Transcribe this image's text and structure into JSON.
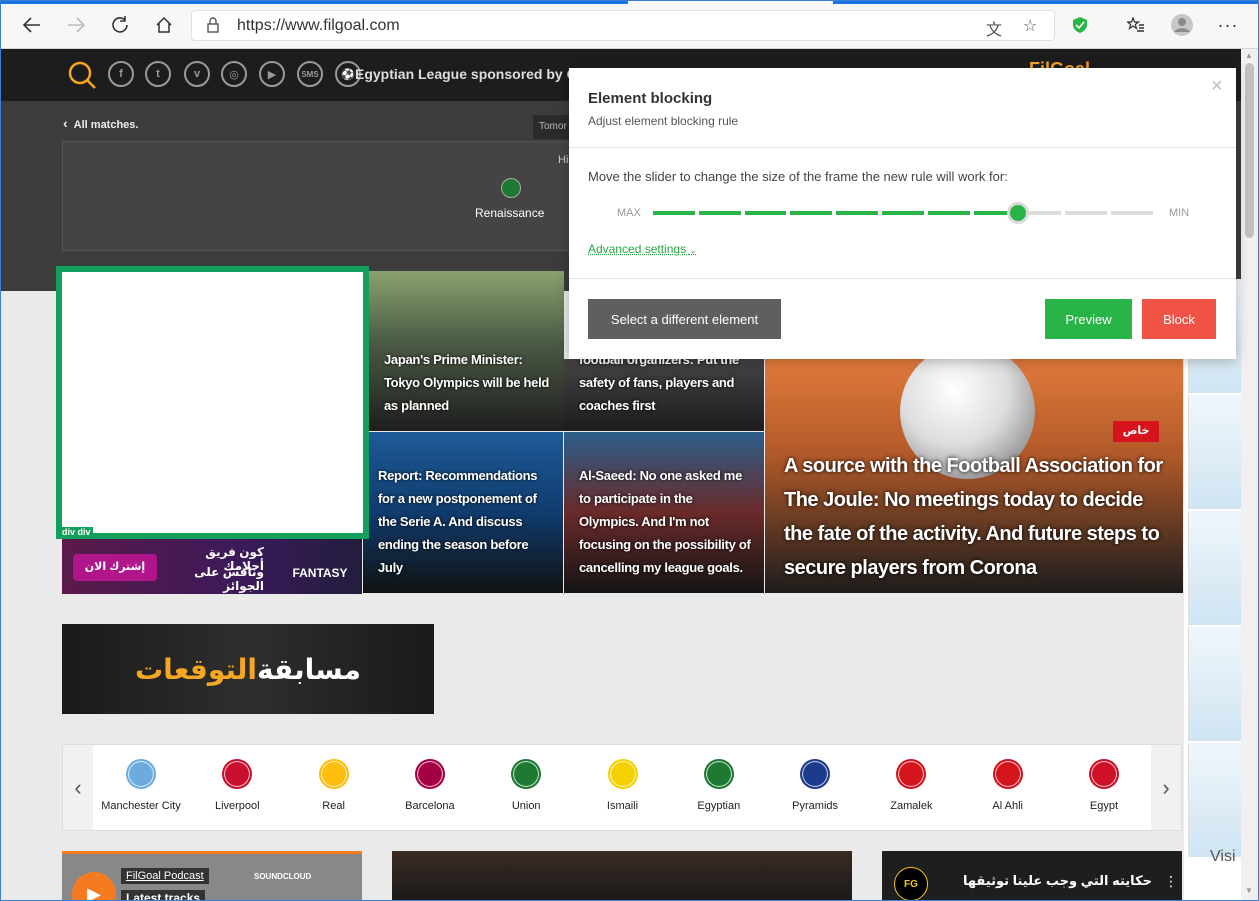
{
  "browser": {
    "url": "https://www.filgoal.com",
    "accent": "#1a73e8"
  },
  "header": {
    "title": "Egyptian League sponsored by OPPO",
    "social_icons": [
      "search-icon",
      "facebook-icon",
      "twitter-icon",
      "vine-icon",
      "instagram-icon",
      "youtube-icon",
      "sms-icon",
      "ball-icon"
    ],
    "sms_label": "SMS",
    "logo": "FilGoal"
  },
  "matches": {
    "all_label": "All matches.",
    "tab_label": "Tomor",
    "match_time_partial": "Hi",
    "team": "Renaissance"
  },
  "blocked": {
    "label": "div div",
    "color": "#12a05c"
  },
  "stories": {
    "s1": "Japan's Prime Minister: Tokyo Olympics will be held as planned",
    "s2": "football organizers: Put the safety of fans, players and coaches first",
    "s3": "Report: Recommendations for a new postponement of the Serie A. And discuss ending the season before July",
    "s4": "Al-Saeed: No one asked me to participate in the Olympics. And I'm not focusing on the possibility of cancelling my league goals.",
    "big": "A source with the Football Association for The Joule: No meetings today to decide the fate of the activity. And future steps to secure players from Corona",
    "big_tag": "خاص"
  },
  "fantasy": {
    "cta": "إشترك الان",
    "line1": "كون فريق أحلامك",
    "line2": "ونافس على الجوائز",
    "logo": "FANTASY"
  },
  "predictions": {
    "part_a": "مسابقة",
    "part_b": "التوقعات"
  },
  "teams": [
    {
      "name": "Manchester City",
      "color": "#6cabdd"
    },
    {
      "name": "Liverpool",
      "color": "#c8102e"
    },
    {
      "name": "Real",
      "color": "#febe10"
    },
    {
      "name": "Barcelona",
      "color": "#a50044"
    },
    {
      "name": "Union",
      "color": "#1e7a32"
    },
    {
      "name": "Ismaili",
      "color": "#f5d000"
    },
    {
      "name": "Egyptian",
      "color": "#1e7a32"
    },
    {
      "name": "Pyramids",
      "color": "#1d3b8c"
    },
    {
      "name": "Zamalek",
      "color": "#d6141e"
    },
    {
      "name": "Al Ahli",
      "color": "#d6141e"
    },
    {
      "name": "Egypt",
      "color": "#ce1126"
    }
  ],
  "bottom": {
    "podcast_label": "FilGoal Podcast",
    "podcast_sub": "Latest tracks",
    "soundcloud": "SOUNDCLOUD",
    "video_title": "حكايته التي وجب علينا توثيقها"
  },
  "ads": {
    "visit": "Visi"
  },
  "dialog": {
    "title": "Element blocking",
    "subtitle": "Adjust element blocking rule",
    "instruction": "Move the slider to change the size of the frame the new rule will work for:",
    "max": "MAX",
    "min": "MIN",
    "slider_steps": 11,
    "slider_value": 8,
    "advanced": "Advanced settings",
    "select_button": "Select a different element",
    "preview_button": "Preview",
    "block_button": "Block",
    "colors": {
      "green": "#28b446",
      "red": "#f05245",
      "gray": "#5f5f5f"
    }
  }
}
